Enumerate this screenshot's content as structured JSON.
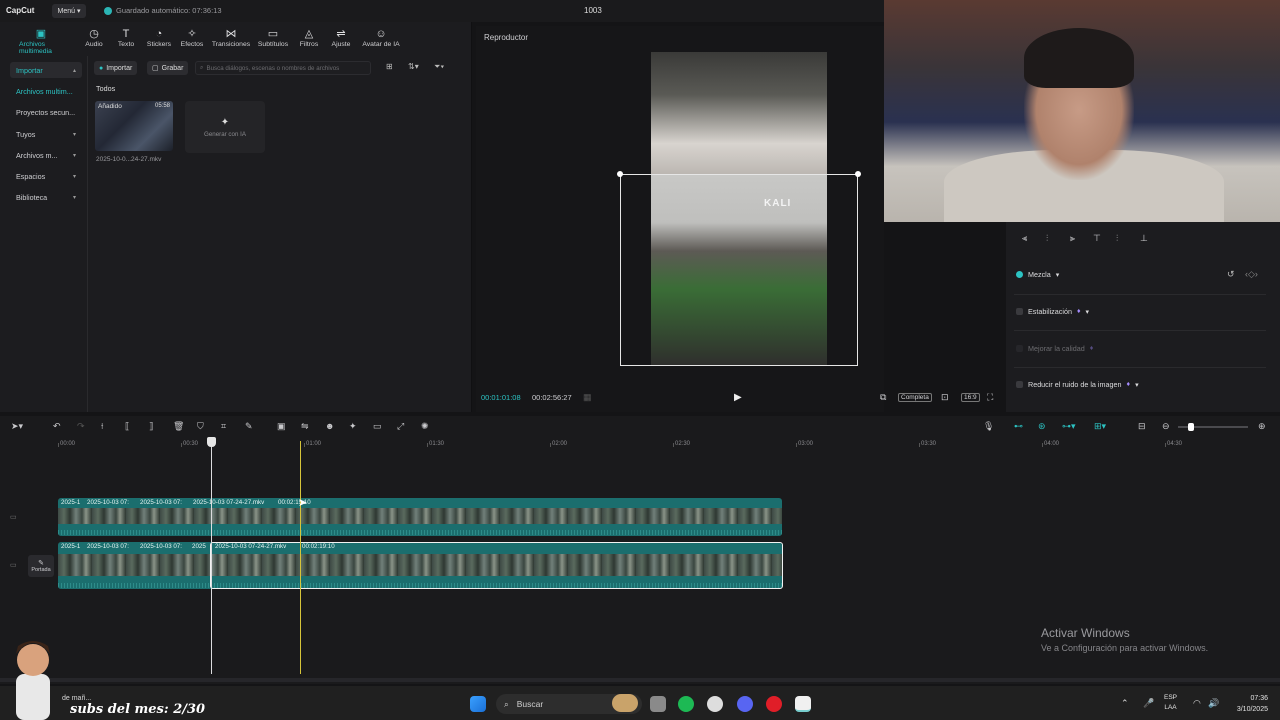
{
  "titlebar": {
    "logo": "CapCut",
    "menu": "Menú",
    "autosave": "Guardado automático: 07:36:13",
    "project": "1003"
  },
  "tools": [
    {
      "label": "Archivos multimedia",
      "icon": "media-icon",
      "glyph": "▣"
    },
    {
      "label": "Audio",
      "icon": "audio-icon",
      "glyph": "◷"
    },
    {
      "label": "Texto",
      "icon": "text-icon",
      "glyph": "T"
    },
    {
      "label": "Stickers",
      "icon": "sticker-icon",
      "glyph": "◔"
    },
    {
      "label": "Efectos",
      "icon": "effects-icon",
      "glyph": "✧"
    },
    {
      "label": "Transiciones",
      "icon": "transition-icon",
      "glyph": "⋈"
    },
    {
      "label": "Subtítulos",
      "icon": "subtitle-icon",
      "glyph": "▭"
    },
    {
      "label": "Filtros",
      "icon": "filter-icon",
      "glyph": "◬"
    },
    {
      "label": "Ajuste",
      "icon": "adjust-icon",
      "glyph": "⇌"
    },
    {
      "label": "Avatar de IA",
      "icon": "ai-avatar-icon",
      "glyph": "☺"
    }
  ],
  "sidebar": {
    "items": [
      {
        "label": "Importar",
        "chev": "▴"
      },
      {
        "label": "Archivos multim...",
        "chev": ""
      },
      {
        "label": "Proyectos secun...",
        "chev": ""
      },
      {
        "label": "Tuyos",
        "chev": "▾"
      },
      {
        "label": "Archivos m...",
        "chev": "▾"
      },
      {
        "label": "Espacios",
        "chev": "▾"
      },
      {
        "label": "Biblioteca",
        "chev": "▾"
      }
    ]
  },
  "media": {
    "import_btn": "Importar",
    "record_btn": "Grabar",
    "search_placeholder": "Busca diálogos, escenas o nombres de archivos",
    "section": "Todos",
    "clip": {
      "badge": "Añadido",
      "duration": "05:58",
      "name": "2025-10-0...24-27.mkv"
    },
    "gen_ia": "Generar con IA"
  },
  "player": {
    "title": "Reproductor",
    "overlay_text": "KALI",
    "current_time": "00:01:01:08",
    "total_time": "00:02:56:27",
    "quality": "Completa",
    "ratio": "16:9"
  },
  "right_panel": {
    "mezcla": "Mezcla",
    "estabilizacion": "Estabilización",
    "mejorar": "Mejorar la calidad",
    "reducir": "Reducir el ruido de la imagen"
  },
  "timeline": {
    "ruler": [
      "00:00",
      "00:30",
      "01:00",
      "01:30",
      "02:00",
      "02:30",
      "03:00",
      "03:30",
      "04:00",
      "04:30"
    ],
    "track1_labels": [
      "2025-1",
      "2025-10-03 07:",
      "2025-10-03 07:",
      "2025-10-03 07-24-27.mkv",
      "00:02:19:10"
    ],
    "track2_labels": [
      "2025-1",
      "2025-10-03 07:",
      "2025-10-03 07:",
      "2025",
      "2025-10-03 07-24-27.mkv",
      "00:02:19:10"
    ],
    "cover": "Portada"
  },
  "watermark": {
    "line1": "Activar Windows",
    "line2": "Ve a Configuración para activar Windows."
  },
  "overlay": {
    "subs": "subs del mes: 2/30",
    "note": "de mañ..."
  },
  "taskbar": {
    "search": "Buscar",
    "lang1": "ESP",
    "lang2": "LAA",
    "time": "07:36",
    "date": "3/10/2025"
  },
  "colors": {
    "accent": "#2cc3c3",
    "track": "#1b6e6e",
    "playhead_yellow": "#d6c43a",
    "background": "#141416"
  }
}
